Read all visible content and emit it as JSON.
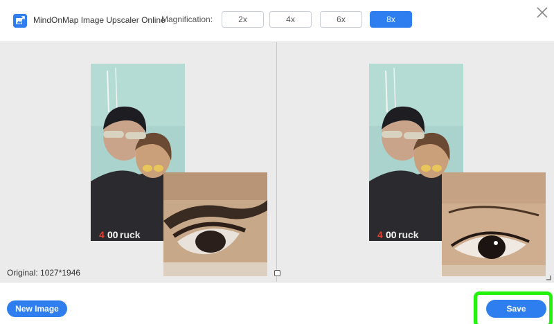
{
  "header": {
    "app_title": "MindOnMap Image Upscaler Online",
    "magnification_label": "Magnification:",
    "magnification_options": [
      "2x",
      "4x",
      "6x",
      "8x"
    ],
    "selected_magnification": "8x"
  },
  "preview": {
    "original_info": "Original: 1027*1946"
  },
  "footer": {
    "new_image_label": "New Image",
    "save_label": "Save"
  },
  "colors": {
    "accent": "#2f7ef0",
    "highlight": "#22f20c",
    "background": "#ebebeb"
  },
  "icons": {
    "logo": "image-upscale-icon",
    "close": "close-icon",
    "compare": "compare-handle-icon",
    "resize": "resize-corner-icon"
  }
}
